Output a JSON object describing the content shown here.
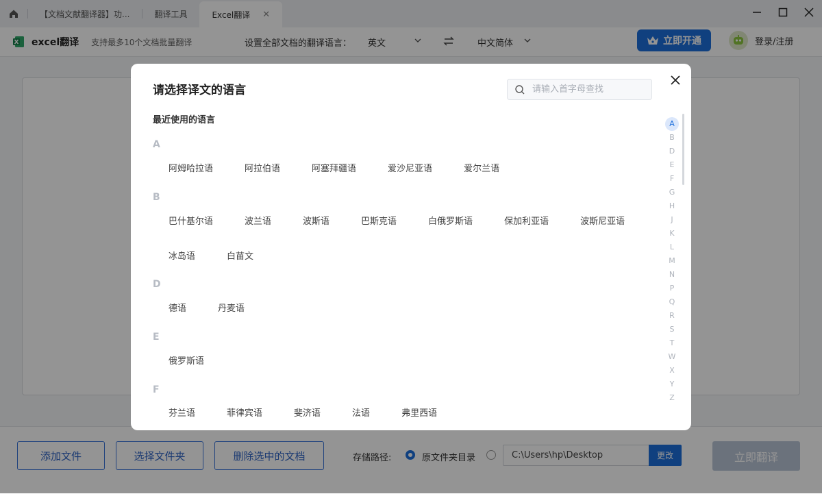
{
  "tabs": [
    {
      "label": "【文档文献翻译器】功..."
    },
    {
      "label": "翻译工具"
    },
    {
      "label": "Excel翻译"
    }
  ],
  "toolbar": {
    "app_name": "excel翻译",
    "app_sub": "支持最多10个文档批量翻译",
    "lang_label": "设置全部文档的翻译语言：",
    "source_lang": "英文",
    "target_lang": "中文简体",
    "vip_label": "立即开通",
    "login_label": "登录/注册"
  },
  "bottom": {
    "add_file": "添加文件",
    "select_folder": "选择文件夹",
    "delete_selected": "删除选中的文档",
    "storage_label": "存储路径:",
    "original_folder": "原文件夹目录",
    "path_value": "C:\\Users\\hp\\Desktop",
    "change_label": "更改",
    "translate_now": "立即翻译"
  },
  "modal": {
    "title": "请选择译文的语言",
    "search_placeholder": "请输入首字母查找",
    "recent_label": "最近使用的语言",
    "groups": [
      {
        "letter": "A",
        "rows": [
          [
            "阿姆哈拉语",
            "阿拉伯语",
            "阿塞拜疆语",
            "爱沙尼亚语",
            "爱尔兰语"
          ]
        ]
      },
      {
        "letter": "B",
        "rows": [
          [
            "巴什基尔语",
            "波兰语",
            "波斯语",
            "巴斯克语",
            "白俄罗斯语",
            "保加利亚语",
            "波斯尼亚语"
          ],
          [
            "冰岛语",
            "白苗文"
          ]
        ]
      },
      {
        "letter": "D",
        "rows": [
          [
            "德语",
            "丹麦语"
          ]
        ]
      },
      {
        "letter": "E",
        "rows": [
          [
            "俄罗斯语"
          ]
        ]
      },
      {
        "letter": "F",
        "rows": [
          [
            "芬兰语",
            "菲律宾语",
            "斐济语",
            "法语",
            "弗里西语"
          ]
        ]
      }
    ],
    "alphabet": [
      "A",
      "B",
      "D",
      "E",
      "F",
      "G",
      "H",
      "J",
      "K",
      "L",
      "M",
      "N",
      "P",
      "Q",
      "R",
      "S",
      "T",
      "W",
      "X",
      "Y",
      "Z"
    ],
    "active_letter": "A"
  },
  "colors": {
    "accent": "#1d6fdb"
  }
}
